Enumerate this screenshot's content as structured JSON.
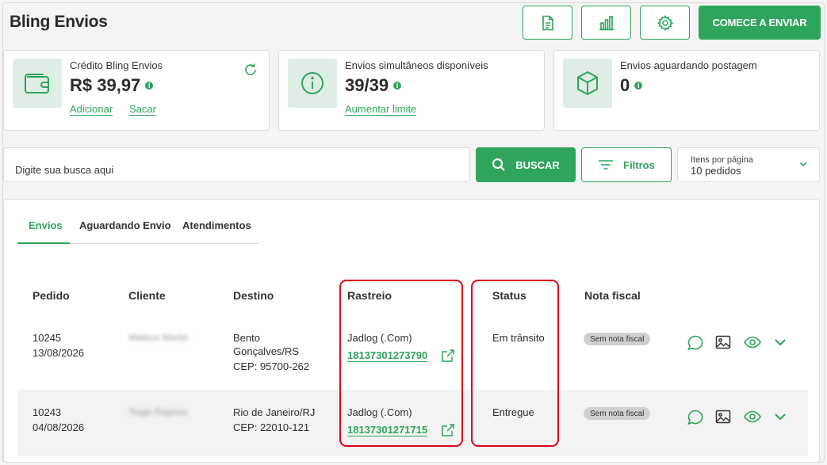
{
  "app": {
    "title": "Bling Envios"
  },
  "header": {
    "report_icon": "document-icon",
    "chart_icon": "bar-chart-icon",
    "settings_icon": "gear-icon",
    "primary_button": "COMECE A ENVIAR"
  },
  "cards": {
    "credit": {
      "label": "Crédito Bling Envios",
      "value": "R$ 39,97",
      "link_add": "Adicionar",
      "link_withdraw": "Sacar"
    },
    "simultaneous": {
      "label": "Envios simultâneos disponíveis",
      "value": "39/39",
      "link": "Aumentar limite"
    },
    "awaiting": {
      "label": "Envios aguardando postagem",
      "value": "0"
    }
  },
  "search": {
    "placeholder": "Digite sua busca aqui",
    "button": "BUSCAR",
    "filters": "Filtros"
  },
  "pagination": {
    "label": "Itens por página",
    "value": "10 pedidos"
  },
  "tabs": [
    "Envios",
    "Aguardando Envio",
    "Atendimentos"
  ],
  "table": {
    "headers": {
      "order": "Pedido",
      "client": "Cliente",
      "destination": "Destino",
      "tracking": "Rastreio",
      "status": "Status",
      "invoice": "Nota fiscal"
    },
    "rows": [
      {
        "order": "10245",
        "date": "13/08/2026",
        "client": "Mateus Martin",
        "dest_line1": "Bento",
        "dest_line2": "Gonçalves/RS",
        "dest_line3": "CEP: 95700-262",
        "carrier": "Jadlog (.Com)",
        "tracking": "18137301273790",
        "status": "Em trânsito",
        "invoice": "Sem nota fiscal"
      },
      {
        "order": "10243",
        "date": "04/08/2026",
        "client": "Tiago Raposo",
        "dest_line1": "Rio de Janeiro/RJ",
        "dest_line2": "CEP: 22010-121",
        "carrier": "Jadlog (.Com)",
        "tracking": "18137301271715",
        "status": "Entregue",
        "invoice": "Sem nota fiscal"
      }
    ]
  },
  "colors": {
    "brand": "#2fa45c",
    "highlight": "#e2001a",
    "icon_bg": "#dfeee4"
  }
}
